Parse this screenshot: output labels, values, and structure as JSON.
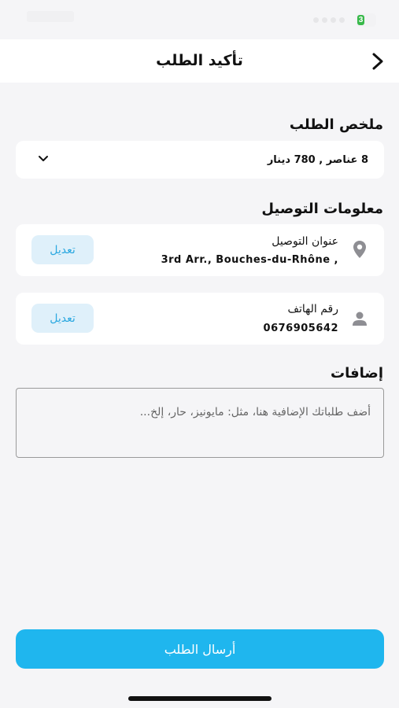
{
  "header": {
    "title": "تأكيد الطلب",
    "back_icon": "chevron-left-icon"
  },
  "summary": {
    "section_title": "ملخص الطلب",
    "text": "8 عناصر , 780 دينار",
    "toggle_icon": "chevron-down-icon"
  },
  "delivery": {
    "section_title": "معلومات التوصيل",
    "address": {
      "label": "عنوان التوصيل",
      "value": "3rd Arr., Bouches-du-Rhône ,",
      "icon": "location-pin-icon",
      "edit_label": "تعديل"
    },
    "phone": {
      "label": "رقم الهاتف",
      "value": "0676905642",
      "icon": "person-icon",
      "edit_label": "تعديل"
    }
  },
  "extras": {
    "section_title": "إضافات",
    "placeholder": "أضف طلباتك الإضافية هنا، مثل: مايونيز، حار، إلخ..."
  },
  "submit_label": "أرسال الطلب",
  "colors": {
    "accent": "#1fb6ee",
    "edit_bg": "#dff0fa",
    "edit_text": "#2ba8e0",
    "background": "#f5f5f7",
    "card": "#ffffff"
  }
}
